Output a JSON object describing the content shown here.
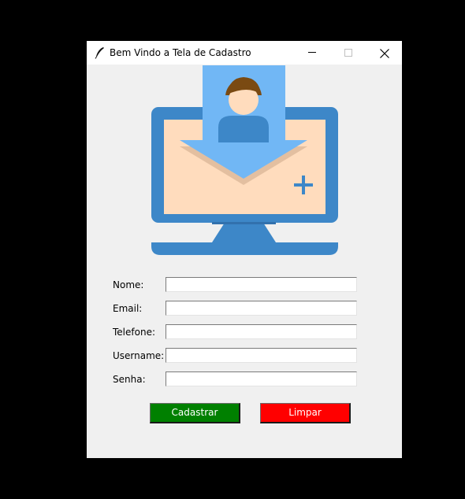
{
  "window": {
    "title": "Bem Vindo a Tela de Cadastro",
    "icons": {
      "app": "feather-icon",
      "minimize": "minimize-icon",
      "maximize": "maximize-icon",
      "close": "close-icon"
    }
  },
  "illustration": {
    "icon": "computer-user-registration-icon",
    "colors": {
      "monitor": "#3d87c8",
      "screen": "#ffdcbd",
      "card": "#71b7f5",
      "hair": "#7a4a12",
      "face": "#ffdcbd",
      "plus": "#3d87c8"
    }
  },
  "form": {
    "fields": [
      {
        "label": "Nome:",
        "value": ""
      },
      {
        "label": "Email:",
        "value": ""
      },
      {
        "label": "Telefone:",
        "value": ""
      },
      {
        "label": "Username:",
        "value": ""
      },
      {
        "label": "Senha:",
        "value": ""
      }
    ]
  },
  "buttons": {
    "cadastrar": {
      "label": "Cadastrar",
      "color": "#008000"
    },
    "limpar": {
      "label": "Limpar",
      "color": "#ff0000"
    }
  }
}
